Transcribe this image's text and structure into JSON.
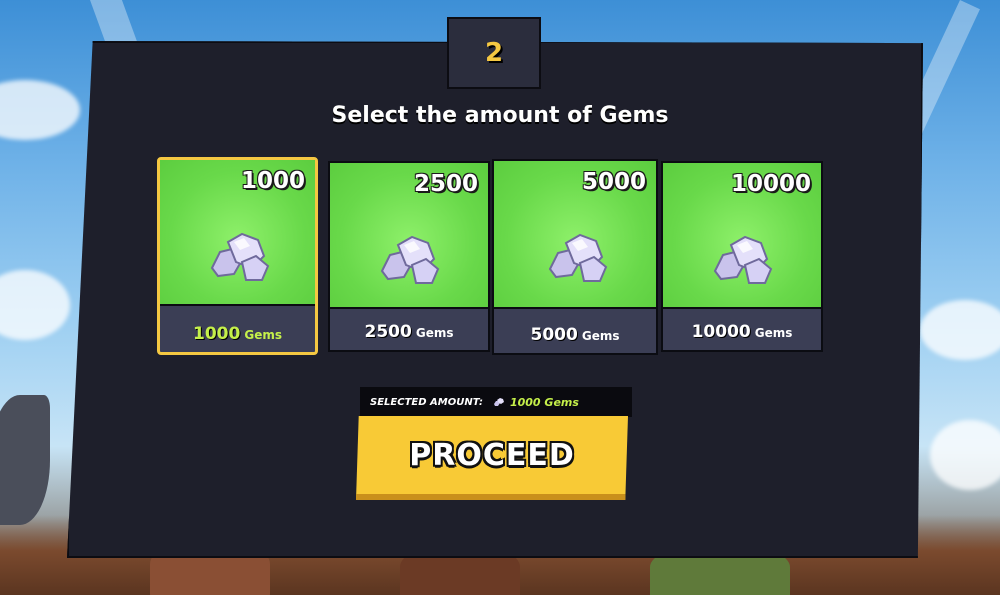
{
  "step": {
    "number": "2"
  },
  "title": "Select the amount of Gems",
  "packages": [
    {
      "amount": "1000",
      "label_number": "1000",
      "label_unit": "Gems",
      "selected": true
    },
    {
      "amount": "2500",
      "label_number": "2500",
      "label_unit": "Gems",
      "selected": false
    },
    {
      "amount": "5000",
      "label_number": "5000",
      "label_unit": "Gems",
      "selected": false
    },
    {
      "amount": "10000",
      "label_number": "10000",
      "label_unit": "Gems",
      "selected": false
    }
  ],
  "selection": {
    "label": "SELECTED AMOUNT:",
    "value": "1000 Gems",
    "icon": "gem-icon"
  },
  "proceed": {
    "label": "PROCEED"
  },
  "colors": {
    "panel": "#1e1f2b",
    "card_green": "#69d94a",
    "accent_yellow": "#f5c842",
    "selected_text": "#c5f04a"
  }
}
